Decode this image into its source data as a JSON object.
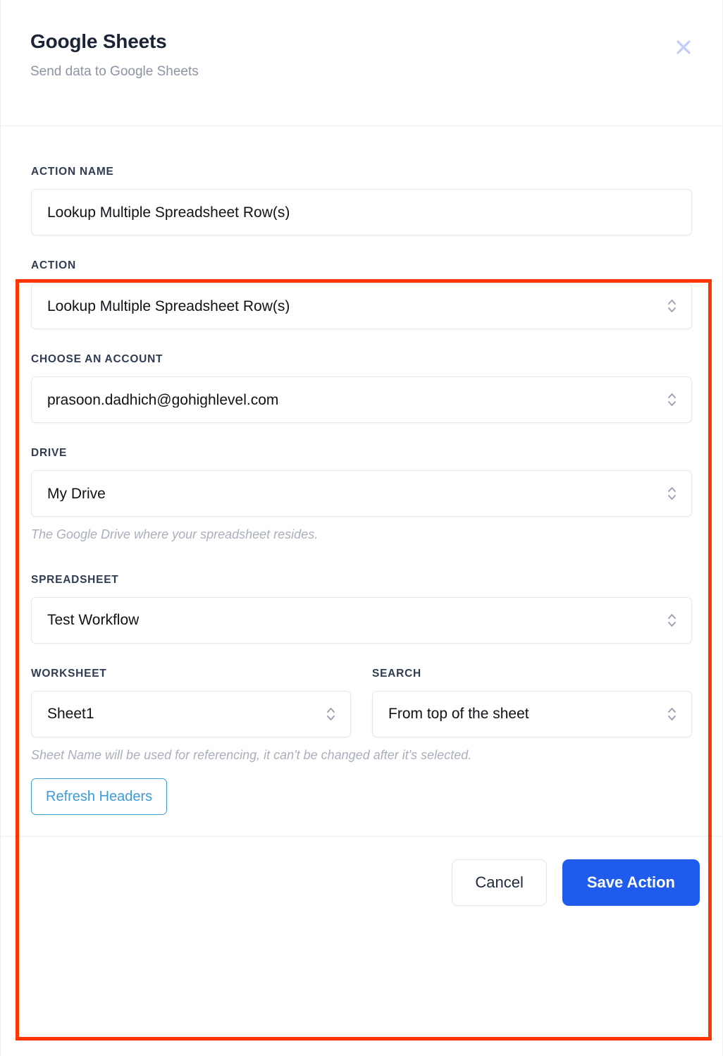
{
  "header": {
    "title": "Google Sheets",
    "subtitle": "Send data to Google Sheets",
    "close_icon": "close-icon"
  },
  "form": {
    "action_name": {
      "label": "ACTION NAME",
      "value": "Lookup Multiple Spreadsheet Row(s)",
      "type": "text"
    },
    "action": {
      "label": "ACTION",
      "value": "Lookup Multiple Spreadsheet Row(s)",
      "type": "select"
    },
    "account": {
      "label": "CHOOSE AN ACCOUNT",
      "value": "prasoon.dadhich@gohighlevel.com",
      "type": "select"
    },
    "drive": {
      "label": "DRIVE",
      "value": "My Drive",
      "type": "select",
      "help": "The Google Drive where your spreadsheet resides."
    },
    "spreadsheet": {
      "label": "SPREADSHEET",
      "value": "Test Workflow",
      "type": "select"
    },
    "worksheet": {
      "label": "WORKSHEET",
      "value": "Sheet1",
      "type": "select"
    },
    "search": {
      "label": "SEARCH",
      "value": "From top of the sheet",
      "type": "select"
    },
    "worksheet_help": "Sheet Name will be used for referencing, it can't be changed after it's selected."
  },
  "buttons": {
    "refresh_headers": "Refresh Headers",
    "cancel": "Cancel",
    "save": "Save Action"
  },
  "colors": {
    "highlight_border": "#fc3503",
    "primary": "#1f5ced",
    "link": "#3d9bd6",
    "label": "#2f3c52",
    "help": "#a9afbc",
    "close": "#c3cdf7"
  }
}
